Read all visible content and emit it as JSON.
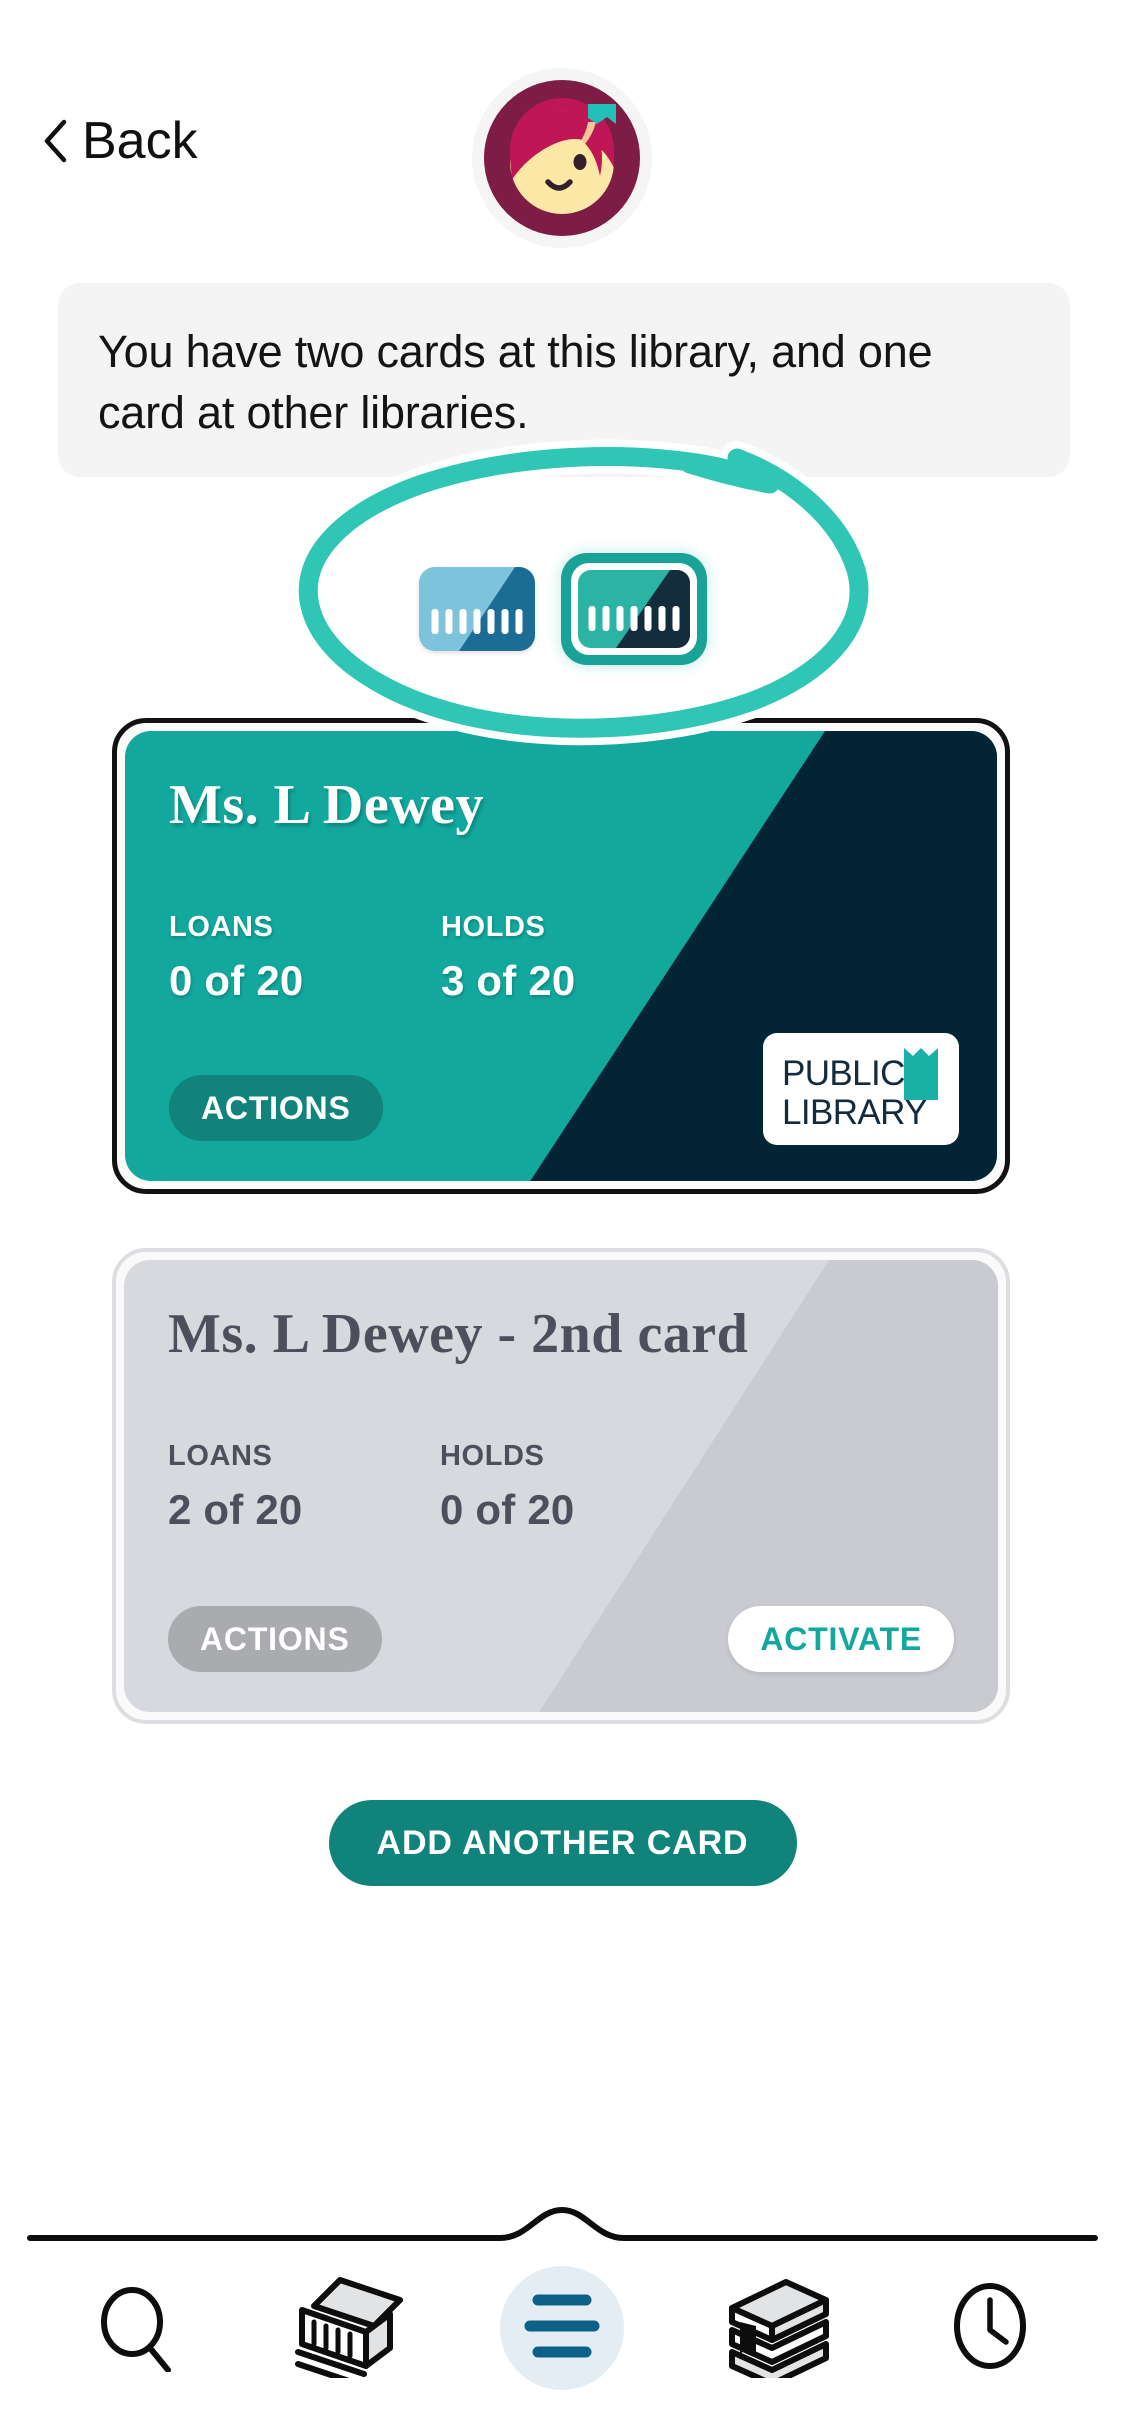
{
  "header": {
    "back_label": "Back",
    "back_icon": "chevron-left-icon",
    "avatar_icon": "user-avatar-icon"
  },
  "banner": {
    "text": "You have two cards at this library, and one card at other libraries."
  },
  "card_selector": {
    "items": [
      {
        "icon": "library-card-icon",
        "selected": false,
        "colors": {
          "light": "#7cc3db",
          "dark": "#1c6d96"
        }
      },
      {
        "icon": "library-card-icon",
        "selected": true,
        "colors": {
          "light": "#2bb4a3",
          "dark": "#142d3c"
        }
      }
    ]
  },
  "cards": [
    {
      "title": "Ms. L Dewey",
      "active": true,
      "loans_label": "LOANS",
      "loans_value": "0 of 20",
      "holds_label": "HOLDS",
      "holds_value": "3 of 20",
      "actions_label": "ACTIONS",
      "logo_line1": "PUBLIC",
      "logo_line2": "LIBRARY",
      "colors": {
        "base": "#12a89d",
        "diagonal": "#022434",
        "actions": "#12837b"
      }
    },
    {
      "title": "Ms. L Dewey - 2nd card",
      "active": false,
      "loans_label": "LOANS",
      "loans_value": "2 of 20",
      "holds_label": "HOLDS",
      "holds_value": "0 of 20",
      "actions_label": "ACTIONS",
      "activate_label": "ACTIVATE",
      "colors": {
        "base": "#d7d9de",
        "diagonal": "#c9cbd1",
        "actions": "#a9abaf",
        "activate_text": "#12a89d"
      }
    }
  ],
  "add_card_button": {
    "label": "ADD ANOTHER CARD",
    "color": "#10837a"
  },
  "annotation": {
    "shape": "hand-drawn-ellipse",
    "color": "#2fc6b6",
    "outline": "#ffffff"
  },
  "bottom_nav": {
    "active_index": 2,
    "active_color": "#0d6189",
    "active_bg": "#e3edf3",
    "items": [
      {
        "icon": "search-icon",
        "name": "search"
      },
      {
        "icon": "library-building-icon",
        "name": "library"
      },
      {
        "icon": "menu-lines-icon",
        "name": "menu"
      },
      {
        "icon": "books-stack-icon",
        "name": "shelf"
      },
      {
        "icon": "clock-icon",
        "name": "history"
      }
    ]
  }
}
